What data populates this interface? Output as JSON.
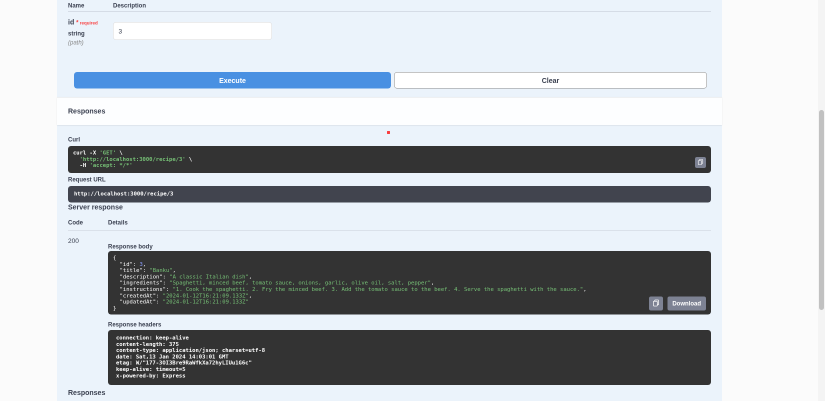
{
  "colors": {
    "accent": "#4990e2",
    "panel_bg": "#ebf3fb",
    "code_bg": "#333333",
    "code_string": "#77c277",
    "code_number": "#8c9eff",
    "required_red": "#f93e3e"
  },
  "parameters": {
    "columns": {
      "name": "Name",
      "description": "Description"
    },
    "param": {
      "name": "id",
      "required_star": "*",
      "required_label": "required",
      "type": "string",
      "location": "(path)",
      "value": "3"
    }
  },
  "actions": {
    "execute": "Execute",
    "clear": "Clear"
  },
  "responses_section": {
    "title": "Responses"
  },
  "curl": {
    "label": "Curl",
    "lines": [
      [
        {
          "t": "curl -X ",
          "c": "p"
        },
        {
          "t": "'GET'",
          "c": "s"
        },
        {
          "t": " \\",
          "c": "p"
        }
      ],
      [
        {
          "t": "  ",
          "c": "p"
        },
        {
          "t": "'http://localhost:3000/recipe/3'",
          "c": "s"
        },
        {
          "t": " \\",
          "c": "p"
        }
      ],
      [
        {
          "t": "  -H ",
          "c": "p"
        },
        {
          "t": "'accept: */*'",
          "c": "s"
        }
      ]
    ]
  },
  "request_url": {
    "label": "Request URL",
    "value": "http://localhost:3000/recipe/3"
  },
  "server_response": {
    "label": "Server response",
    "columns": {
      "code": "Code",
      "details": "Details"
    },
    "code": "200",
    "response_body_label": "Response body",
    "body_lines": [
      [
        {
          "t": "{",
          "c": "p"
        }
      ],
      [
        {
          "t": "  \"id\": ",
          "c": "p"
        },
        {
          "t": "3",
          "c": "n"
        },
        {
          "t": ",",
          "c": "p"
        }
      ],
      [
        {
          "t": "  \"title\": ",
          "c": "p"
        },
        {
          "t": "\"Banku\"",
          "c": "s"
        },
        {
          "t": ",",
          "c": "p"
        }
      ],
      [
        {
          "t": "  \"description\": ",
          "c": "p"
        },
        {
          "t": "\"A classic Italian dish\"",
          "c": "s"
        },
        {
          "t": ",",
          "c": "p"
        }
      ],
      [
        {
          "t": "  \"ingredients\": ",
          "c": "p"
        },
        {
          "t": "\"Spaghetti, minced beef, tomato sauce, onions, garlic, olive oil, salt, pepper\"",
          "c": "s"
        },
        {
          "t": ",",
          "c": "p"
        }
      ],
      [
        {
          "t": "  \"instructions\": ",
          "c": "p"
        },
        {
          "t": "\"1. Cook the spaghetti. 2. Fry the minced beef. 3. Add the tomato sauce to the beef. 4. Serve the spaghetti with the sauce.\"",
          "c": "s"
        },
        {
          "t": ",",
          "c": "p"
        }
      ],
      [
        {
          "t": "  \"createdAt\": ",
          "c": "p"
        },
        {
          "t": "\"2024-01-12T16:21:09.133Z\"",
          "c": "s"
        },
        {
          "t": ",",
          "c": "p"
        }
      ],
      [
        {
          "t": "  \"updatedAt\": ",
          "c": "p"
        },
        {
          "t": "\"2024-01-12T16:21:09.133Z\"",
          "c": "s"
        }
      ],
      [
        {
          "t": "}",
          "c": "p"
        }
      ]
    ],
    "download_label": "Download",
    "response_headers_label": "Response headers",
    "header_lines": [
      "connection: keep-alive",
      "content-length: 375",
      "content-type: application/json; charset=utf-8",
      "date: Sat,13 Jan 2024 14:03:01 GMT",
      "etag: W/\"177-3OI3Bre9RaWfkXa72hyLIUu1G6c\"",
      "keep-alive: timeout=5",
      "x-powered-by: Express"
    ]
  },
  "responses_doc": {
    "title": "Responses"
  }
}
